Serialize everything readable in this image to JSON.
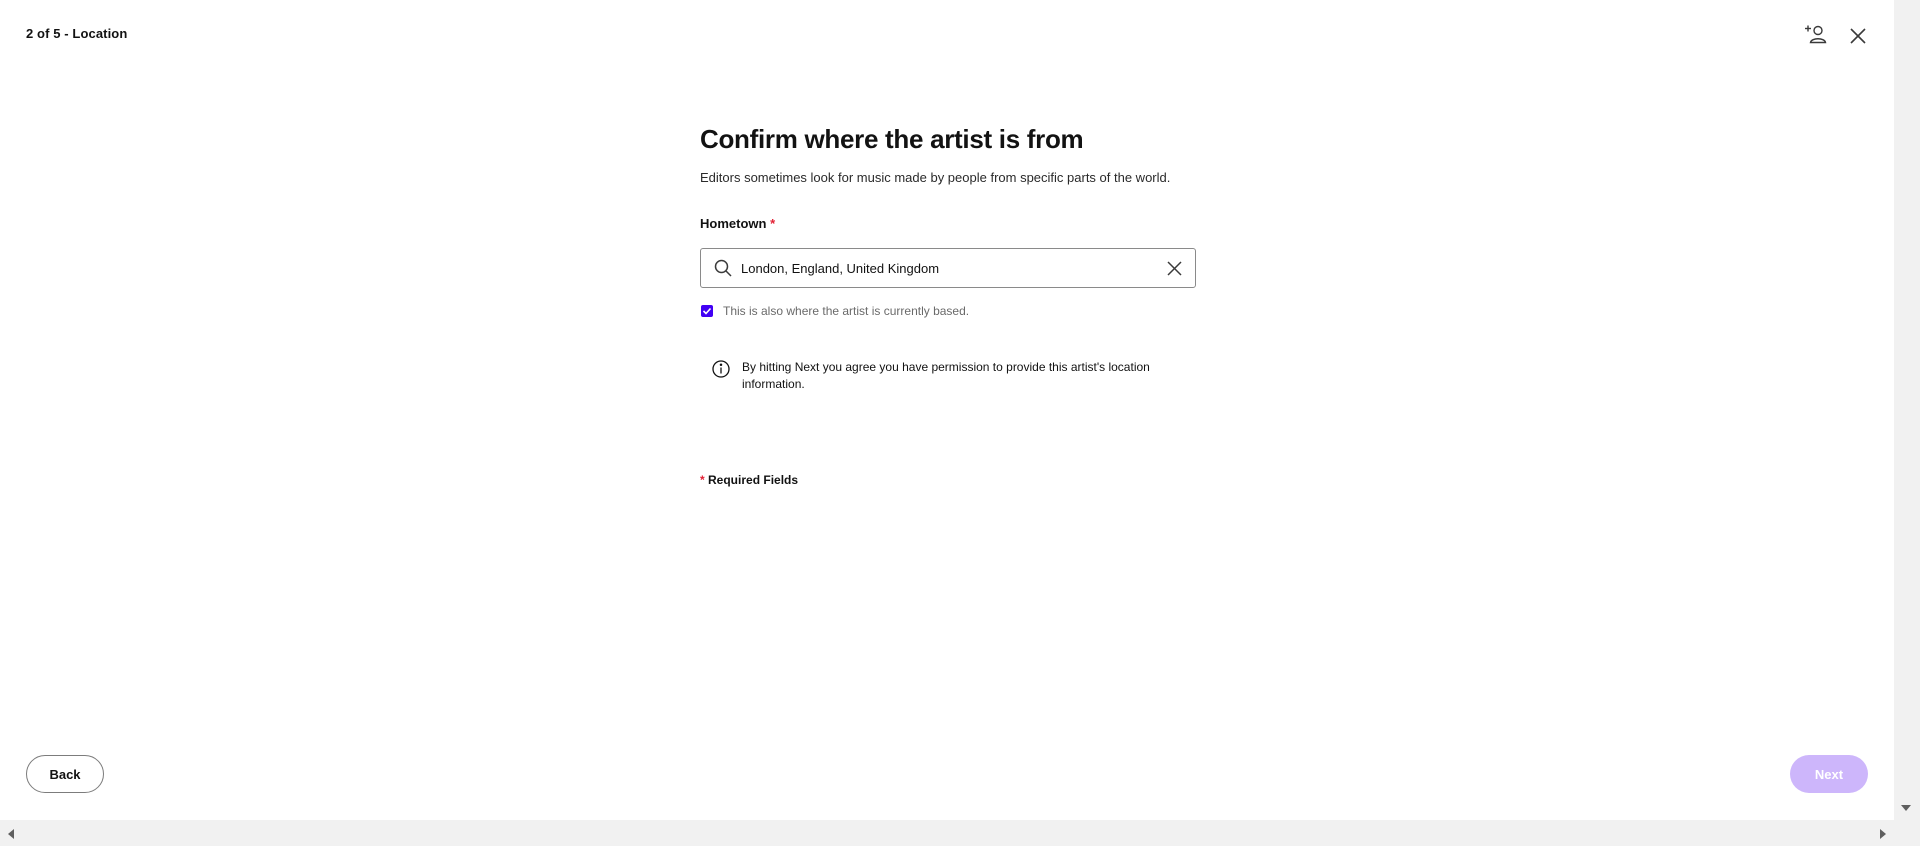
{
  "header": {
    "step_label": "2 of 5 - Location",
    "add_artist_icon": "add-person-icon",
    "close_icon": "close-icon"
  },
  "main": {
    "title": "Confirm where the artist is from",
    "subtitle": "Editors sometimes look for music made by people from specific parts of the world.",
    "hometown": {
      "label": "Hometown",
      "required_marker": "*",
      "value": "London, England, United Kingdom",
      "search_icon": "search-icon",
      "clear_icon": "clear-icon"
    },
    "currently_based": {
      "checked": true,
      "label": "This is also where the artist is currently based."
    },
    "info": {
      "icon": "info-icon",
      "text": "By hitting Next you agree you have permission to provide this artist's location information."
    },
    "required_note": {
      "marker": "*",
      "text": "Required Fields"
    }
  },
  "footer": {
    "back_label": "Back",
    "next_label": "Next"
  },
  "colors": {
    "accent": "#4100f4",
    "next_disabled_bg": "#cdb6fb",
    "required": "#e22134"
  }
}
